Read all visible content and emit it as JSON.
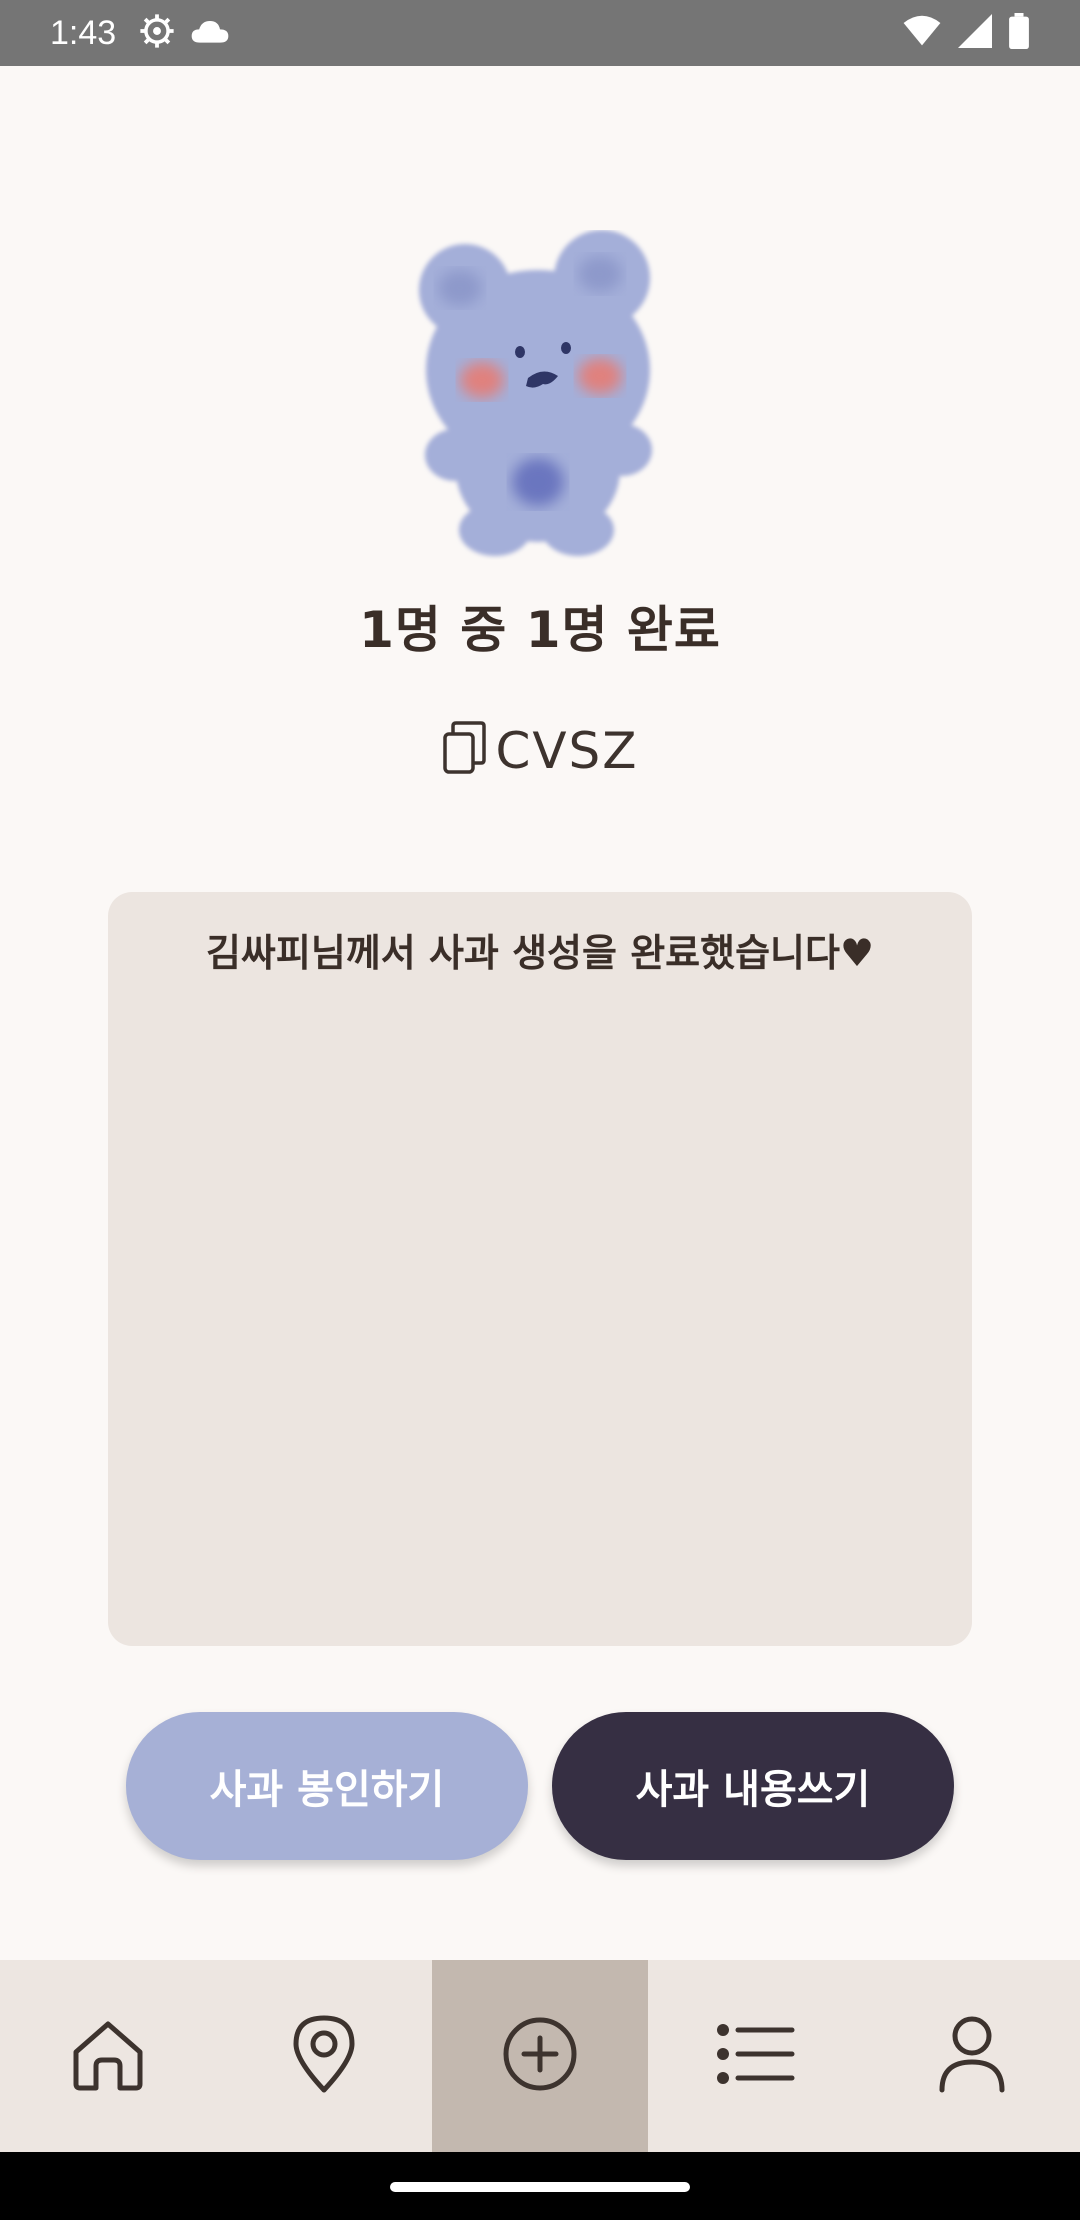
{
  "status_bar": {
    "time": "1:43",
    "left_icons": [
      "settings-gear-icon",
      "cloud-icon"
    ],
    "right_icons": [
      "wifi-icon",
      "signal-icon",
      "battery-icon"
    ]
  },
  "main": {
    "progress_text": "1명 중 1명 완료",
    "code": "CVSZ",
    "message": "김싸피님께서 사과 생성을 완료했습니다♥",
    "buttons": {
      "seal_label": "사과 봉인하기",
      "write_label": "사과 내용쓰기"
    }
  },
  "bottom_nav": {
    "items": [
      {
        "icon": "home-icon",
        "active": false
      },
      {
        "icon": "map-pin-icon",
        "active": false
      },
      {
        "icon": "plus-circle-icon",
        "active": true
      },
      {
        "icon": "list-icon",
        "active": false
      },
      {
        "icon": "user-icon",
        "active": false
      }
    ]
  },
  "colors": {
    "background": "#FBF8F6",
    "card": "#ECE5E0",
    "seal_button": "#A6B0D6",
    "write_button": "#362F43",
    "nav_background": "#EDE6E1",
    "nav_active": "#C3B8AF",
    "bear": "#A4AFD9",
    "bear_cheek": "#E0817E"
  }
}
